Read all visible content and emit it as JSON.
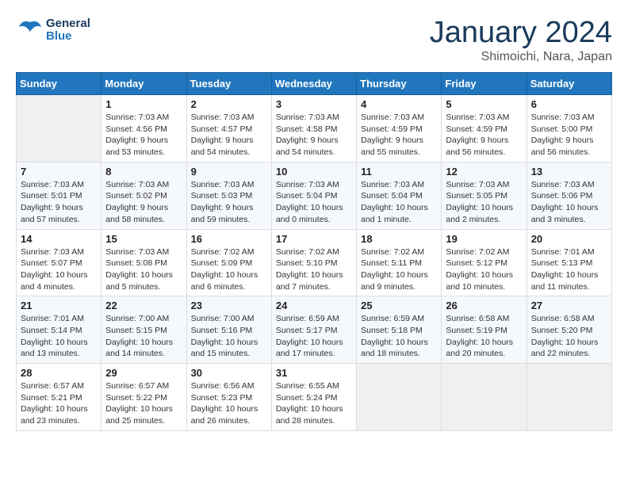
{
  "header": {
    "logo_line1": "General",
    "logo_line2": "Blue",
    "month": "January 2024",
    "location": "Shimoichi, Nara, Japan"
  },
  "weekdays": [
    "Sunday",
    "Monday",
    "Tuesday",
    "Wednesday",
    "Thursday",
    "Friday",
    "Saturday"
  ],
  "weeks": [
    [
      {
        "day": "",
        "sunrise": "",
        "sunset": "",
        "daylight": ""
      },
      {
        "day": "1",
        "sunrise": "Sunrise: 7:03 AM",
        "sunset": "Sunset: 4:56 PM",
        "daylight": "Daylight: 9 hours and 53 minutes."
      },
      {
        "day": "2",
        "sunrise": "Sunrise: 7:03 AM",
        "sunset": "Sunset: 4:57 PM",
        "daylight": "Daylight: 9 hours and 54 minutes."
      },
      {
        "day": "3",
        "sunrise": "Sunrise: 7:03 AM",
        "sunset": "Sunset: 4:58 PM",
        "daylight": "Daylight: 9 hours and 54 minutes."
      },
      {
        "day": "4",
        "sunrise": "Sunrise: 7:03 AM",
        "sunset": "Sunset: 4:59 PM",
        "daylight": "Daylight: 9 hours and 55 minutes."
      },
      {
        "day": "5",
        "sunrise": "Sunrise: 7:03 AM",
        "sunset": "Sunset: 4:59 PM",
        "daylight": "Daylight: 9 hours and 56 minutes."
      },
      {
        "day": "6",
        "sunrise": "Sunrise: 7:03 AM",
        "sunset": "Sunset: 5:00 PM",
        "daylight": "Daylight: 9 hours and 56 minutes."
      }
    ],
    [
      {
        "day": "7",
        "sunrise": "Sunrise: 7:03 AM",
        "sunset": "Sunset: 5:01 PM",
        "daylight": "Daylight: 9 hours and 57 minutes."
      },
      {
        "day": "8",
        "sunrise": "Sunrise: 7:03 AM",
        "sunset": "Sunset: 5:02 PM",
        "daylight": "Daylight: 9 hours and 58 minutes."
      },
      {
        "day": "9",
        "sunrise": "Sunrise: 7:03 AM",
        "sunset": "Sunset: 5:03 PM",
        "daylight": "Daylight: 9 hours and 59 minutes."
      },
      {
        "day": "10",
        "sunrise": "Sunrise: 7:03 AM",
        "sunset": "Sunset: 5:04 PM",
        "daylight": "Daylight: 10 hours and 0 minutes."
      },
      {
        "day": "11",
        "sunrise": "Sunrise: 7:03 AM",
        "sunset": "Sunset: 5:04 PM",
        "daylight": "Daylight: 10 hours and 1 minute."
      },
      {
        "day": "12",
        "sunrise": "Sunrise: 7:03 AM",
        "sunset": "Sunset: 5:05 PM",
        "daylight": "Daylight: 10 hours and 2 minutes."
      },
      {
        "day": "13",
        "sunrise": "Sunrise: 7:03 AM",
        "sunset": "Sunset: 5:06 PM",
        "daylight": "Daylight: 10 hours and 3 minutes."
      }
    ],
    [
      {
        "day": "14",
        "sunrise": "Sunrise: 7:03 AM",
        "sunset": "Sunset: 5:07 PM",
        "daylight": "Daylight: 10 hours and 4 minutes."
      },
      {
        "day": "15",
        "sunrise": "Sunrise: 7:03 AM",
        "sunset": "Sunset: 5:08 PM",
        "daylight": "Daylight: 10 hours and 5 minutes."
      },
      {
        "day": "16",
        "sunrise": "Sunrise: 7:02 AM",
        "sunset": "Sunset: 5:09 PM",
        "daylight": "Daylight: 10 hours and 6 minutes."
      },
      {
        "day": "17",
        "sunrise": "Sunrise: 7:02 AM",
        "sunset": "Sunset: 5:10 PM",
        "daylight": "Daylight: 10 hours and 7 minutes."
      },
      {
        "day": "18",
        "sunrise": "Sunrise: 7:02 AM",
        "sunset": "Sunset: 5:11 PM",
        "daylight": "Daylight: 10 hours and 9 minutes."
      },
      {
        "day": "19",
        "sunrise": "Sunrise: 7:02 AM",
        "sunset": "Sunset: 5:12 PM",
        "daylight": "Daylight: 10 hours and 10 minutes."
      },
      {
        "day": "20",
        "sunrise": "Sunrise: 7:01 AM",
        "sunset": "Sunset: 5:13 PM",
        "daylight": "Daylight: 10 hours and 11 minutes."
      }
    ],
    [
      {
        "day": "21",
        "sunrise": "Sunrise: 7:01 AM",
        "sunset": "Sunset: 5:14 PM",
        "daylight": "Daylight: 10 hours and 13 minutes."
      },
      {
        "day": "22",
        "sunrise": "Sunrise: 7:00 AM",
        "sunset": "Sunset: 5:15 PM",
        "daylight": "Daylight: 10 hours and 14 minutes."
      },
      {
        "day": "23",
        "sunrise": "Sunrise: 7:00 AM",
        "sunset": "Sunset: 5:16 PM",
        "daylight": "Daylight: 10 hours and 15 minutes."
      },
      {
        "day": "24",
        "sunrise": "Sunrise: 6:59 AM",
        "sunset": "Sunset: 5:17 PM",
        "daylight": "Daylight: 10 hours and 17 minutes."
      },
      {
        "day": "25",
        "sunrise": "Sunrise: 6:59 AM",
        "sunset": "Sunset: 5:18 PM",
        "daylight": "Daylight: 10 hours and 18 minutes."
      },
      {
        "day": "26",
        "sunrise": "Sunrise: 6:58 AM",
        "sunset": "Sunset: 5:19 PM",
        "daylight": "Daylight: 10 hours and 20 minutes."
      },
      {
        "day": "27",
        "sunrise": "Sunrise: 6:58 AM",
        "sunset": "Sunset: 5:20 PM",
        "daylight": "Daylight: 10 hours and 22 minutes."
      }
    ],
    [
      {
        "day": "28",
        "sunrise": "Sunrise: 6:57 AM",
        "sunset": "Sunset: 5:21 PM",
        "daylight": "Daylight: 10 hours and 23 minutes."
      },
      {
        "day": "29",
        "sunrise": "Sunrise: 6:57 AM",
        "sunset": "Sunset: 5:22 PM",
        "daylight": "Daylight: 10 hours and 25 minutes."
      },
      {
        "day": "30",
        "sunrise": "Sunrise: 6:56 AM",
        "sunset": "Sunset: 5:23 PM",
        "daylight": "Daylight: 10 hours and 26 minutes."
      },
      {
        "day": "31",
        "sunrise": "Sunrise: 6:55 AM",
        "sunset": "Sunset: 5:24 PM",
        "daylight": "Daylight: 10 hours and 28 minutes."
      },
      {
        "day": "",
        "sunrise": "",
        "sunset": "",
        "daylight": ""
      },
      {
        "day": "",
        "sunrise": "",
        "sunset": "",
        "daylight": ""
      },
      {
        "day": "",
        "sunrise": "",
        "sunset": "",
        "daylight": ""
      }
    ]
  ]
}
